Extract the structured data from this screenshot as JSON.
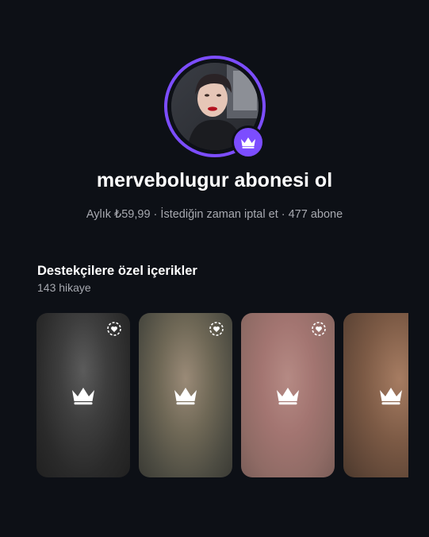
{
  "profile": {
    "title": "mervebolugur abonesi ol",
    "subtitle": "Aylık ₺59,99 · İstediğin zaman iptal et · 477 abone",
    "avatar_icon": "profile-photo",
    "badge_icon": "crown-icon"
  },
  "exclusive": {
    "heading": "Destekçilere özel içerikler",
    "count": "143 hikaye"
  },
  "colors": {
    "accent": "#7c4dff",
    "background": "#0d1016",
    "secondary_text": "#a7a9b0"
  }
}
